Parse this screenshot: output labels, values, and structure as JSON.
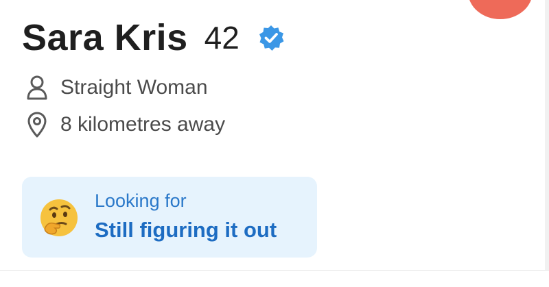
{
  "profile": {
    "name": "Sara Kris",
    "age": "42",
    "verified_icon": "verified-badge-icon",
    "orientation": "Straight Woman",
    "distance": "8 kilometres away"
  },
  "looking_for": {
    "label": "Looking for",
    "value": "Still figuring it out",
    "emoji_icon": "thinking-face-icon"
  },
  "colors": {
    "verified": "#3b97e6",
    "card_background": "#e6f3fd",
    "accent_text": "#1d6cc2",
    "action_button": "#ee6a59"
  }
}
